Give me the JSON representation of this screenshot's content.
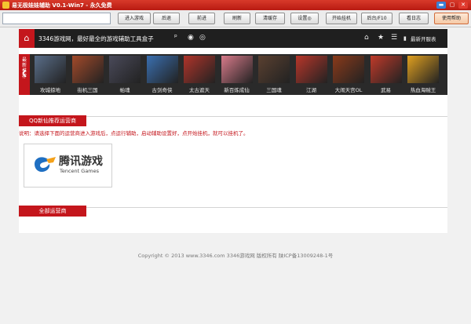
{
  "window": {
    "title": "易无极娃娃辅助 V0.1-Win7 - 永久免费",
    "controls": {
      "minimize": "▬",
      "maximize": "▢",
      "close": "✕"
    }
  },
  "toolbar": {
    "url_value": "",
    "buttons": [
      "进入游戏",
      "后退",
      "前进",
      "刷新",
      "清缓存",
      "设置◎",
      "开始挂机",
      "后台/F10",
      "看日志",
      "使用帮助"
    ]
  },
  "nav": {
    "home_icon": "home-icon",
    "site_title": "3346游戏网，最好最全的游戏辅助工具盒子",
    "icons": [
      "home-icon",
      "star-icon",
      "menu-icon"
    ],
    "latest_link": "最新开服表"
  },
  "strip": {
    "side_label": "最新推荐",
    "arrow": "❮",
    "games": [
      {
        "name": "攻城掠地",
        "color": "#5a6e8a"
      },
      {
        "name": "街机三国",
        "color": "#a34a2a"
      },
      {
        "name": "帕魂",
        "color": "#4a4a5a"
      },
      {
        "name": "古剑奇侠",
        "color": "#3a6fb0"
      },
      {
        "name": "太古遮天",
        "color": "#b0342a"
      },
      {
        "name": "新百炼成仙",
        "color": "#d87a8a"
      },
      {
        "name": "三国魂",
        "color": "#5a4030"
      },
      {
        "name": "江湖",
        "color": "#b8362a"
      },
      {
        "name": "大闹天宫OL",
        "color": "#8a3a1a"
      },
      {
        "name": "武易",
        "color": "#c03a2a"
      },
      {
        "name": "热血海贼王",
        "color": "#e0a020"
      }
    ]
  },
  "section_operators": {
    "heading": "QQ新仙推荐运营商",
    "note": "说明：请选择下面的运营商进入游戏后，点运行辅助，启动辅助设置好，点开始挂机，就可以挂机了。",
    "logo_cn": "腾讯游戏",
    "logo_en": "Tencent Games"
  },
  "section_all": {
    "heading": "全部运营商"
  },
  "footer": {
    "text": "Copyright © 2013 www.3346.com 3346游戏网 版权所有 陕ICP备13009248-1号"
  },
  "colors": {
    "brand_red": "#c4161c",
    "nav_dark": "#1f1f1f"
  }
}
